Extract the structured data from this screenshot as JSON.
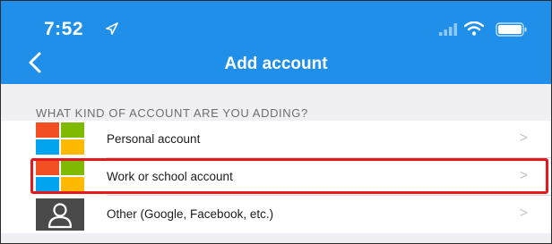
{
  "status_bar": {
    "time": "7:52",
    "icons": [
      "location-arrow-icon",
      "signal-icon",
      "wifi-icon",
      "battery-icon"
    ]
  },
  "nav": {
    "back_icon": "chevron-left-icon",
    "title": "Add account"
  },
  "section": {
    "header": "WHAT KIND OF ACCOUNT ARE YOU ADDING?"
  },
  "accounts": [
    {
      "label": "Personal account",
      "icon": "microsoft-logo-icon",
      "chevron": ">"
    },
    {
      "label": "Work or school account",
      "icon": "microsoft-logo-icon",
      "chevron": ">"
    },
    {
      "label": "Other (Google, Facebook, etc.)",
      "icon": "person-icon",
      "chevron": ">"
    }
  ],
  "colors": {
    "nav_blue": "#1f8fea",
    "highlight_red": "#e8161d",
    "ms_red": "#f25022",
    "ms_green": "#7fba00",
    "ms_blue": "#00a4ef",
    "ms_yellow": "#ffb900"
  }
}
